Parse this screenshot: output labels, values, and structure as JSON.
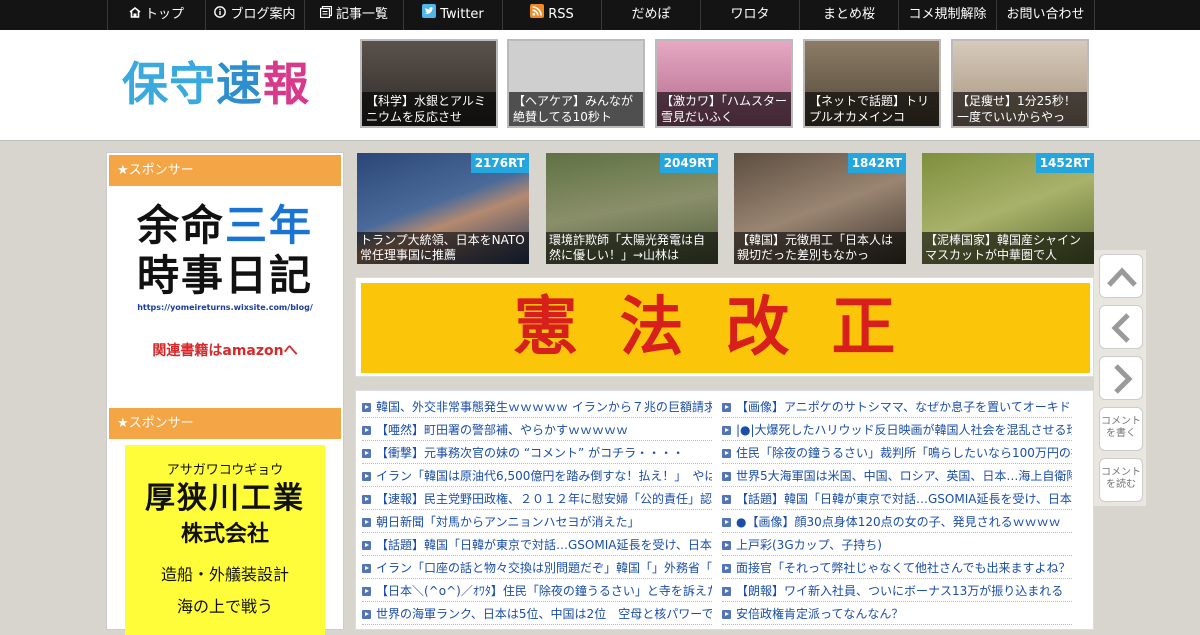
{
  "topnav": {
    "items": [
      {
        "label": "トップ",
        "icon": "home-icon"
      },
      {
        "label": "ブログ案内",
        "icon": "info-icon"
      },
      {
        "label": "記事一覧",
        "icon": "list-icon"
      },
      {
        "label": "Twitter",
        "icon": "twitter-icon"
      },
      {
        "label": "RSS",
        "icon": "rss-icon"
      },
      {
        "label": "だめぽ",
        "icon": ""
      },
      {
        "label": "ワロタ",
        "icon": ""
      },
      {
        "label": "まとめ桜",
        "icon": ""
      },
      {
        "label": "コメ規制解除",
        "icon": ""
      },
      {
        "label": "お問い合わせ",
        "icon": ""
      }
    ]
  },
  "logo": {
    "c1": "保",
    "c2": "守",
    "c3": "速",
    "c4": "報"
  },
  "header_thumbs": [
    {
      "caption": "【科学】水銀とアルミニウムを反応させ",
      "color": "#4a4440"
    },
    {
      "caption": "【ヘアケア】みんなが絶賛してる10秒ト",
      "color": "#cfcfcf"
    },
    {
      "caption": "【激カワ】「ハムスター雪見だいふく",
      "color": "#d98fb0"
    },
    {
      "caption": "【ネットで話題】トリプルオカメインコ",
      "color": "#7a6a58"
    },
    {
      "caption": "【足痩せ】1分25秒！一度でいいからやっ",
      "color": "#c8b9a8"
    }
  ],
  "sidebar": {
    "sponsor1": "★スポンサー",
    "ad1": {
      "l1a": "余命",
      "l1b": "三年",
      "l2": "時事日記",
      "url": "https://yomeireturns.wixsite.com/blog/",
      "amazon": "関連書籍はamazonへ"
    },
    "sponsor2": "★スポンサー",
    "ad2": {
      "kana": "アサガワコウギョウ",
      "name1": "厚狭川工業",
      "name2": "株式会社",
      "line3": "造船・外艤装設計",
      "line4": "海の上で戦う"
    }
  },
  "featured": [
    {
      "rt": "2176RT",
      "caption": "トランプ大統領、日本をNATO常任理事国に推薦",
      "color": "#3a4a6a"
    },
    {
      "rt": "2049RT",
      "caption": "環境詐欺師「太陽光発電は自然に優しい！」→山林は",
      "color": "#6a7a4a"
    },
    {
      "rt": "1842RT",
      "caption": "【韓国】元徴用工「日本人は親切だった差別もなかっ",
      "color": "#6a5a4a"
    },
    {
      "rt": "1452RT",
      "caption": "【泥棒国家】韓国産シャインマスカットが中華圏で人",
      "color": "#8a9a4a"
    }
  ],
  "banner": {
    "text": "憲法改正"
  },
  "articles_left": [
    "韓国、外交非常事態発生ｗｗｗｗｗ イランから７兆の巨額請求",
    "【唖然】町田署の警部補、やらかすｗｗｗｗｗ",
    "【衝撃】元事務次官の妹の “コメント” がコチラ・・・・",
    "イラン「韓国は原油代6,500億円を踏み倒すな！払え！」　やは",
    "【速報】民主党野田政権、２０１２年に慰安婦「公的責任」認",
    "朝日新聞「対馬からアンニョンハセヨが消えた」",
    "【話題】韓国「日韓が東京で対話…GSOMIA延長を受け、日本",
    "イラン「口座の話と物々交換は別問題だぞ」韓国「」外務省「",
    "【日本＼(^o^)／ｵﾜﾀ】住民「除夜の鐘うるさい」と寺を訴えた結",
    "世界の海軍ランク、日本は5位、中国は2位　空母と核パワーで"
  ],
  "articles_right": [
    "【画像】アニポケのサトシママ、なぜか息子を置いてオーキド",
    "|●|大爆死したハリウッド反日映画が韓国人社会を混乱させる珍",
    "住民「除夜の鐘うるさい」裁判所「鳴らしたいなら100万円の損",
    "世界5大海軍国は米国、中国、ロシア、英国、日本…海上自衛隊",
    "【話題】韓国「日韓が東京で対話…GSOMIA延長を受け、日本",
    "●【画像】顔30点身体120点の女の子、発見されるｗｗｗｗ",
    "上戸彩(3Gカップ、子持ち)",
    "面接官「それって弊社じゃなくて他社さんでも出来ますよね？",
    "【朗報】ワイ新入社員、ついにボーナス13万が振り込まれる",
    "安倍政権肯定派ってなんなん？"
  ],
  "side_buttons": {
    "comment_write": "コメントを書く",
    "comment_read": "コメントを読む"
  }
}
